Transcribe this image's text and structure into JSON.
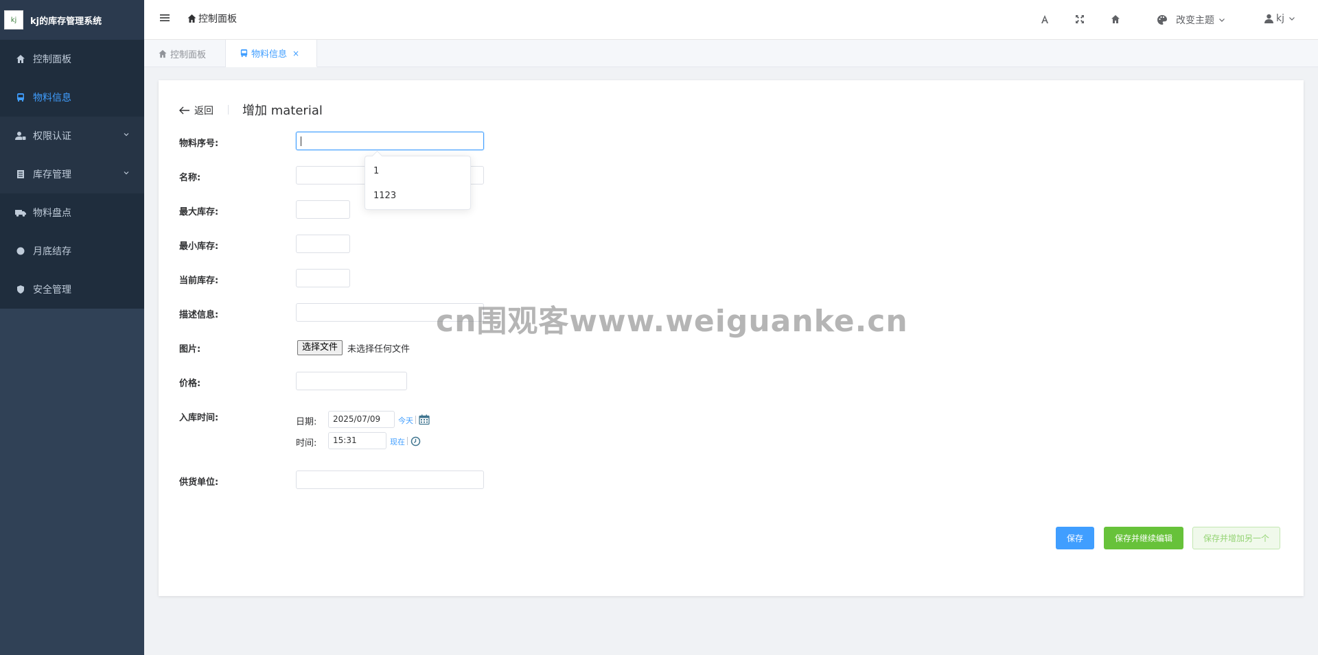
{
  "app": {
    "title": "kj的库存管理系统",
    "logo_text": "kj"
  },
  "sidebar": {
    "items": [
      {
        "label": "控制面板"
      },
      {
        "label": "物料信息"
      },
      {
        "label": "权限认证"
      },
      {
        "label": "库存管理"
      },
      {
        "label": "物料盘点"
      },
      {
        "label": "月底结存"
      },
      {
        "label": "安全管理"
      }
    ]
  },
  "header": {
    "breadcrumb": "控制面板",
    "theme_label": "改变主题",
    "user": "kj"
  },
  "tabs": [
    {
      "label": "控制面板"
    },
    {
      "label": "物料信息",
      "close": "×"
    }
  ],
  "form": {
    "back_label": "返回",
    "title": "增加 material",
    "labels": {
      "serial": "物料序号:",
      "name": "名称:",
      "max_stock": "最大库存:",
      "min_stock": "最小库存:",
      "current_stock": "当前库存:",
      "description": "描述信息:",
      "image": "图片:",
      "price": "价格:",
      "in_time": "入库时间:",
      "supplier": "供货单位:"
    },
    "autocomplete": [
      "1",
      "1123"
    ],
    "file_button": "选择文件",
    "file_status": "未选择任何文件",
    "date_label": "日期:",
    "date_value": "2025/07/09",
    "today_link": "今天",
    "time_label": "时间:",
    "time_value": "15:31",
    "now_link": "现在",
    "buttons": {
      "save": "保存",
      "save_continue": "保存并继续编辑",
      "save_add": "保存并增加另一个"
    }
  },
  "watermark": "cn围观客www.weiguanke.cn",
  "colors": {
    "sidebar_bg": "#304156",
    "accent": "#409eff",
    "success": "#67c23a"
  }
}
